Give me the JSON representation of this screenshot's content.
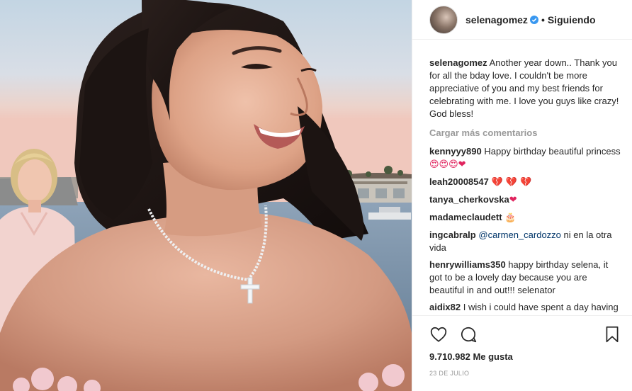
{
  "post": {
    "username": "selenagomez",
    "follow_separator": "•",
    "follow_label": "Siguiendo",
    "verified": true
  },
  "caption": {
    "username": "selenagomez",
    "text": "Another year down.. Thank you for all the bday love. I couldn't be more appreciative of you and my best friends for celebrating with me. I love you guys like crazy! God bless!"
  },
  "load_more": "Cargar más comentarios",
  "comments": [
    {
      "username": "kennyyy890",
      "text": "Happy birthday beautiful princess ",
      "emoji": "😍😍😍❤",
      "emoji_class": "eyes"
    },
    {
      "username": "leah20008547",
      "text": "",
      "emoji": "💔 💔 💔",
      "emoji_class": "heart"
    },
    {
      "username": "tanya_cherkovska",
      "text": "",
      "emoji": "❤",
      "emoji_class": "heart"
    },
    {
      "username": "madameclaudett",
      "text": "",
      "emoji": "🎂",
      "emoji_class": "cake"
    },
    {
      "username": "ingcabralp",
      "mention": "@carmen_cardozzo",
      "text": " ni en la otra vida"
    },
    {
      "username": "henrywilliams350",
      "text": "happy birthday selena, it got to be a lovely day because you are beautiful in and out!!! selenator"
    },
    {
      "username": "aidix82",
      "text": "I wish i could have spent a day having fun with selena",
      "emoji": "😊",
      "emoji_class": "cake"
    }
  ],
  "actions": {
    "like_icon": "heart-outline-icon",
    "comment_icon": "comment-bubble-icon",
    "save_icon": "bookmark-icon"
  },
  "likes_label": "9.710.982 Me gusta",
  "date_label": "23 DE JULIO",
  "colors": {
    "text": "#262626",
    "muted": "#999999",
    "verified": "#3897f0",
    "mention": "#003569"
  }
}
